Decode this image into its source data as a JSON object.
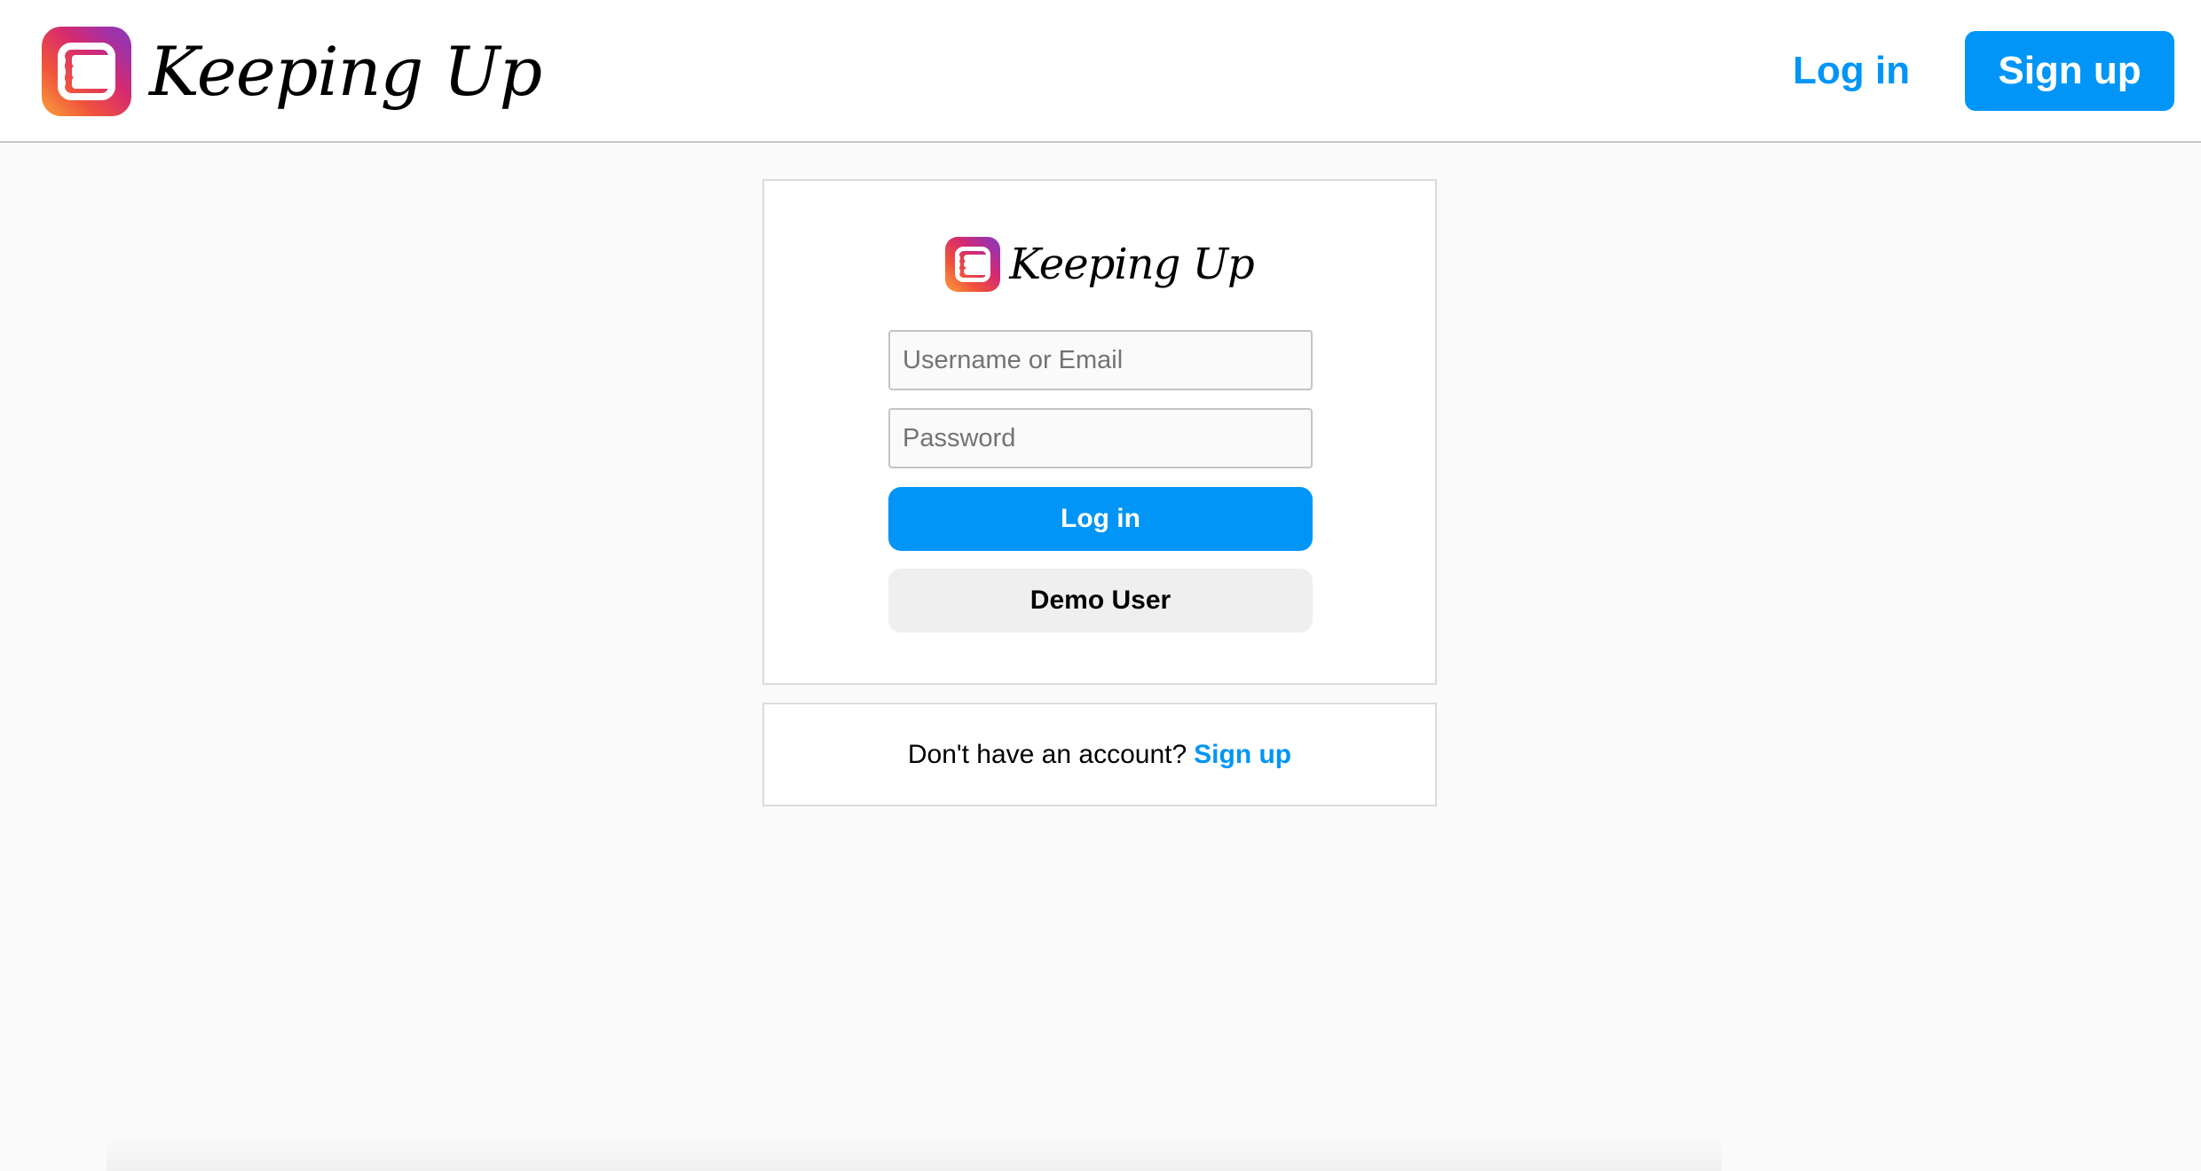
{
  "header": {
    "brand_name": "Keeping Up",
    "login_label": "Log in",
    "signup_label": "Sign up"
  },
  "login_card": {
    "brand_name": "Keeping Up",
    "username_placeholder": "Username or Email",
    "password_placeholder": "Password",
    "login_button": "Log in",
    "demo_button": "Demo User"
  },
  "signup_card": {
    "prompt": "Don't have an account?",
    "link": "Sign up"
  },
  "icons": {
    "app_logo": "list-app-icon"
  },
  "colors": {
    "accent": "#0095f6",
    "page_background": "#fafafa",
    "card_border": "#dbdbdb",
    "secondary_button": "#efefef",
    "logo_gradient": [
      "#f9a13a",
      "#f0543c",
      "#d62a6f",
      "#a032a8",
      "#8a3ab9"
    ]
  }
}
